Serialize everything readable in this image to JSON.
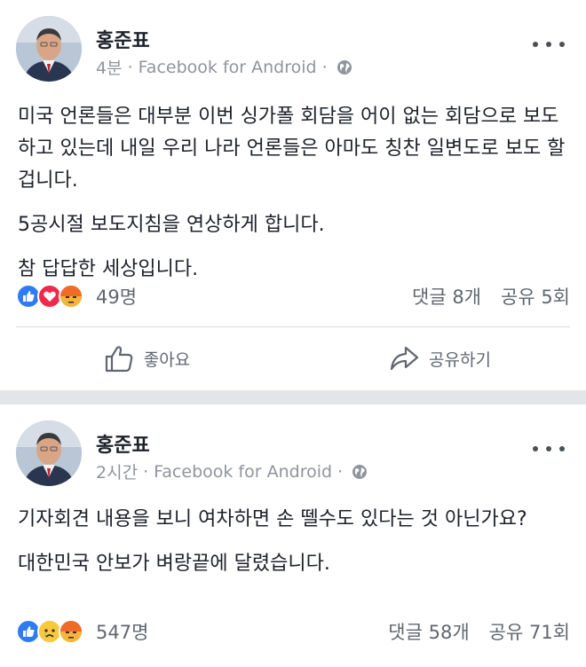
{
  "posts": [
    {
      "author": "홍준표",
      "time": "4분",
      "source": "Facebook for Android",
      "paragraphs": [
        "미국 언론들은 대부분 이번 싱가폴 회담을 어이 없는 회담으로 보도 하고 있는데 내일 우리 나라 언론들은 아마도 칭찬 일변도로 보도 할겁니다.",
        "5공시절 보도지침을 연상하게 합니다.",
        "참 답답한 세상입니다."
      ],
      "reactions": [
        "like-icon",
        "love-icon",
        "angry-icon"
      ],
      "reaction_count": "49명",
      "comments": "댓글 8개",
      "shares": "공유 5회",
      "like_label": "좋아요",
      "share_label": "공유하기"
    },
    {
      "author": "홍준표",
      "time": "2시간",
      "source": "Facebook for Android",
      "paragraphs": [
        "기자회견 내용을 보니 여차하면 손 뗄수도 있다는 것 아닌가요?",
        "대한민국 안보가 벼랑끝에 달렸습니다."
      ],
      "reactions": [
        "like-icon",
        "sad-icon",
        "angry-icon"
      ],
      "reaction_count": "547명",
      "comments": "댓글 58개",
      "shares": "공유 71회"
    }
  ],
  "colors": {
    "like": "#2f7bf6",
    "love": "#f0284a",
    "angry": "#f07b2a",
    "sad": "#f7c93c",
    "meta": "#90949c",
    "separator": "#e4e5e9"
  }
}
